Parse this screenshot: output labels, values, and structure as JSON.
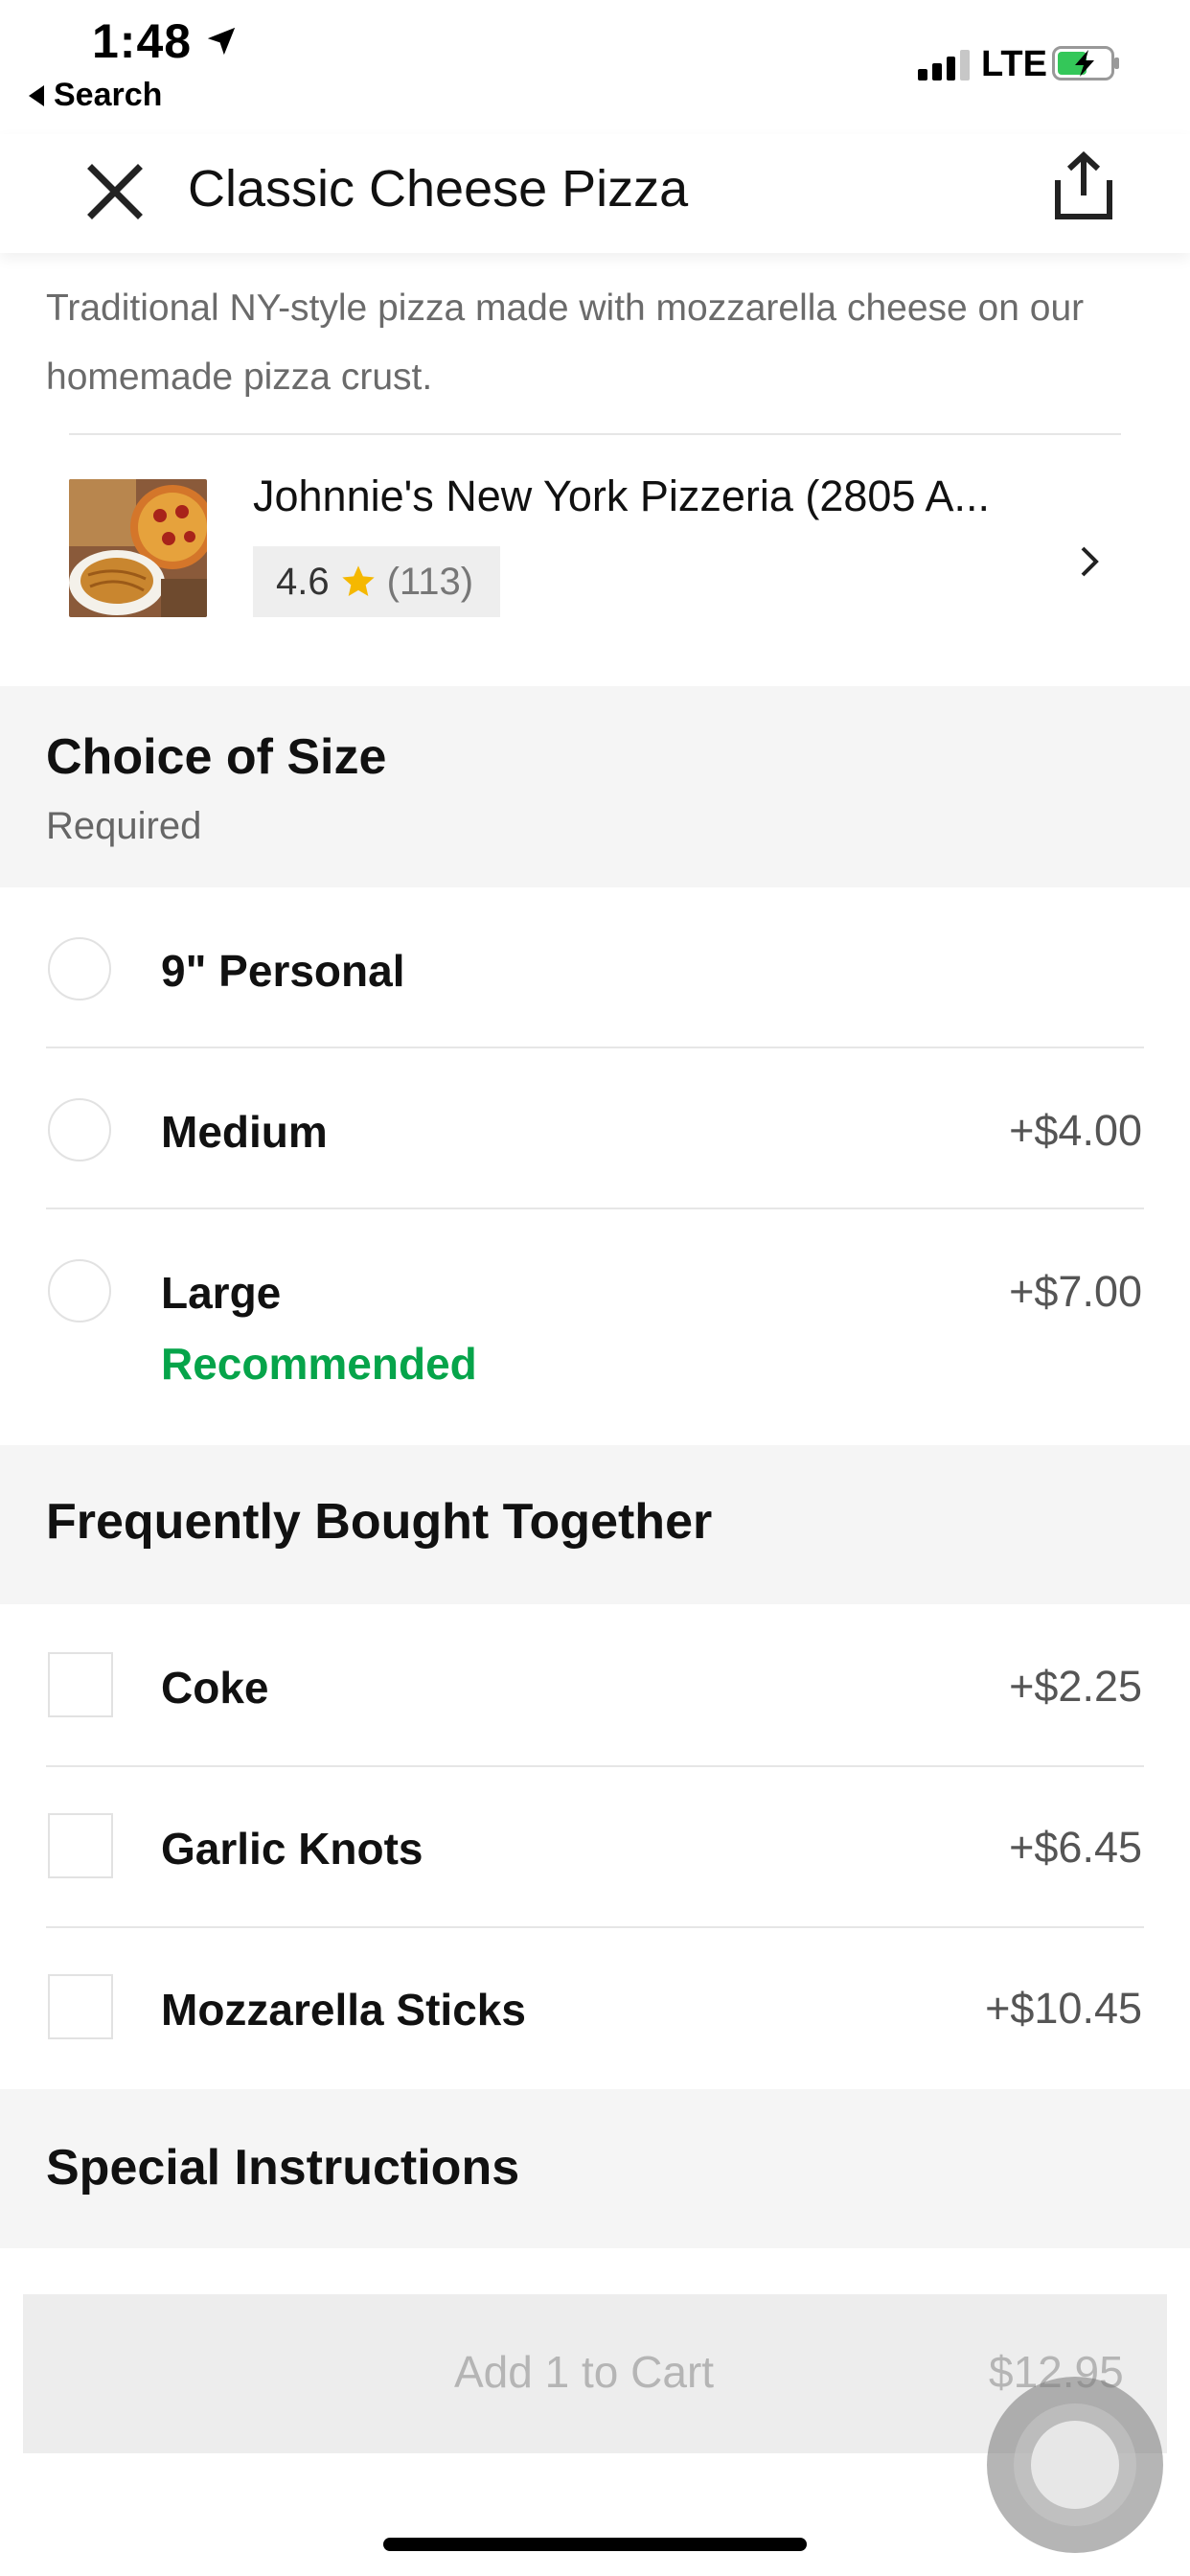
{
  "status_bar": {
    "time": "1:48",
    "back_label": "Search",
    "network": "LTE"
  },
  "header": {
    "title": "Classic Cheese Pizza"
  },
  "item": {
    "description": "Traditional NY-style pizza made with mozzarella cheese on our homemade pizza crust."
  },
  "restaurant": {
    "name": "Johnnie's New York Pizzeria (2805 A...",
    "rating": "4.6",
    "review_count": "(113)"
  },
  "size_section": {
    "title": "Choice of Size",
    "subtitle": "Required",
    "options": [
      {
        "label": "9\" Personal",
        "price": ""
      },
      {
        "label": "Medium",
        "price": "+$4.00"
      },
      {
        "label": "Large",
        "price": "+$7.00",
        "tag": "Recommended"
      }
    ]
  },
  "fbt_section": {
    "title": "Frequently Bought Together",
    "options": [
      {
        "label": "Coke",
        "price": "+$2.25"
      },
      {
        "label": "Garlic Knots",
        "price": "+$6.45"
      },
      {
        "label": "Mozzarella Sticks",
        "price": "+$10.45"
      }
    ]
  },
  "instructions_section": {
    "title": "Special Instructions"
  },
  "cart": {
    "label": "Add 1 to Cart",
    "price": "$12.95"
  },
  "colors": {
    "recommended": "#06a44a",
    "star": "#f5b800",
    "section_bg": "#f5f5f5"
  }
}
